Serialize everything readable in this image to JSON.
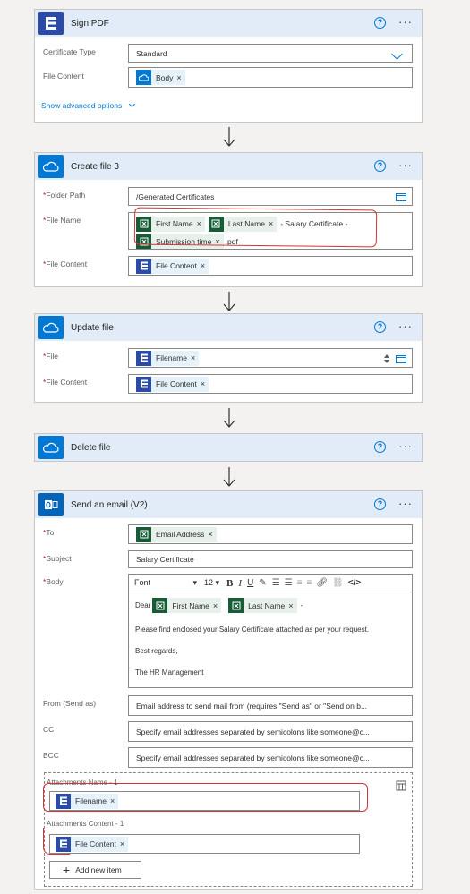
{
  "sign_pdf": {
    "title": "Sign PDF",
    "cert_type_label": "Certificate Type",
    "cert_type_value": "Standard",
    "file_content_label": "File Content",
    "file_content_token": "Body",
    "advanced_link": "Show advanced options"
  },
  "create_file": {
    "title": "Create file 3",
    "folder_label": "Folder Path",
    "folder_value": "/Generated Certificates",
    "filename_label": "File Name",
    "token_first": "First Name",
    "token_last": "Last Name",
    "text_mid": "- Salary Certificate -",
    "token_sub": "Submission time",
    "text_ext": ".pdf",
    "file_content_label": "File Content",
    "file_content_token": "File Content"
  },
  "update_file": {
    "title": "Update file",
    "file_label": "File",
    "file_token": "Filename",
    "content_label": "File Content",
    "content_token": "File Content"
  },
  "delete_file": {
    "title": "Delete file"
  },
  "send_email": {
    "title": "Send an email (V2)",
    "to_label": "To",
    "to_token": "Email Address",
    "subject_label": "Subject",
    "subject_value": "Salary Certificate",
    "body_label": "Body",
    "font_value": "Font",
    "size_value": "12",
    "dear": "Dear",
    "body_first": "First Name",
    "body_last": "Last Name",
    "body_dash": "-",
    "line1": "Please find enclosed your Salary Certificate attached as per your request.",
    "line2": "Best regards,",
    "line3": "The HR Management",
    "from_label": "From (Send as)",
    "from_placeholder": "Email address to send mail from (requires \"Send as\" or \"Send on b...",
    "cc_label": "CC",
    "cc_placeholder": "Specify email addresses separated by semicolons like someone@c...",
    "bcc_label": "BCC",
    "bcc_placeholder": "Specify email addresses separated by semicolons like someone@c...",
    "att_name_label": "Attachments Name - 1",
    "att_name_token": "Filename",
    "att_content_label": "Attachments Content - 1",
    "att_content_token": "File Content",
    "add_item": "Add new item"
  },
  "ui": {
    "required_mark": "*",
    "help_glyph": "?",
    "more_glyph": "···",
    "remove_glyph": "×"
  },
  "colors": {
    "accent": "#0078d4",
    "header_bg": "#e1ecf8",
    "highlight_red": "#d13438"
  }
}
